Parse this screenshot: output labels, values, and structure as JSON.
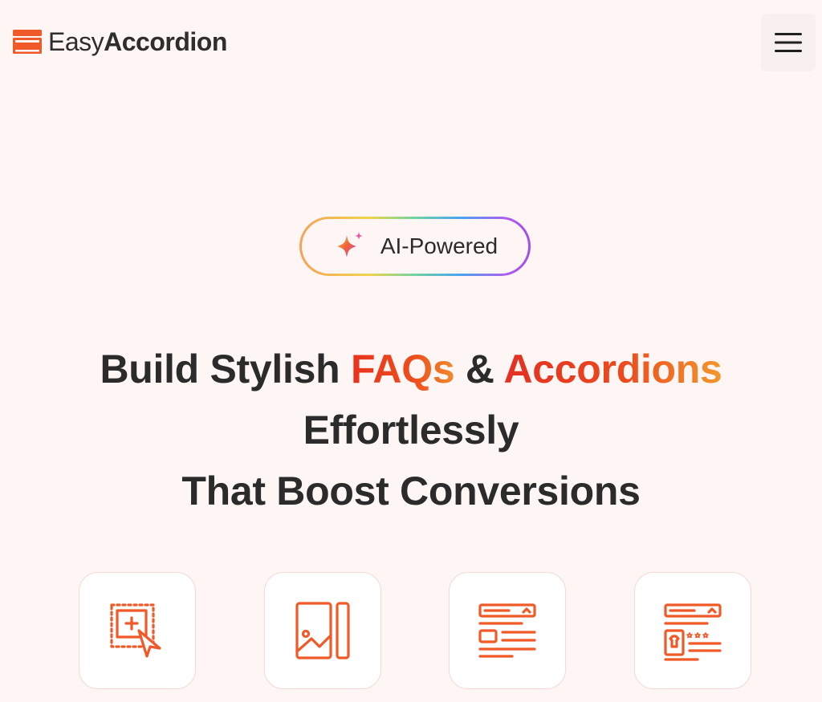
{
  "header": {
    "logo": {
      "icon": "accordion-logo-icon",
      "text_light": "Easy",
      "text_bold": "Accordion"
    },
    "menu_icon": "hamburger-menu-icon"
  },
  "badge": {
    "icon": "sparkle-icon",
    "label": "AI-Powered"
  },
  "headline": {
    "line1_prefix": "Build Stylish ",
    "line1_highlight1": "FAQs",
    "line1_amp": " & ",
    "line1_highlight2": "Accordions",
    "line2": "Effortlessly",
    "line3": "That Boost Conversions"
  },
  "features": [
    {
      "icon": "drag-drop-select-icon"
    },
    {
      "icon": "image-gallery-icon"
    },
    {
      "icon": "content-layout-icon"
    },
    {
      "icon": "product-layout-icon"
    }
  ],
  "colors": {
    "brand_orange": "#f05a28",
    "text_dark": "#2b2b2b",
    "page_bg": "#fdf6f4"
  }
}
